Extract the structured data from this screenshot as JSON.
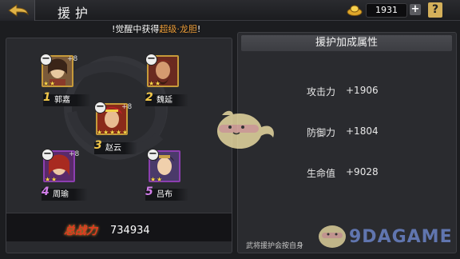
{
  "header": {
    "title": "援护",
    "currency_value": "1931",
    "plus_label": "+",
    "help_label": "?"
  },
  "notice": {
    "prefix": "!觉醒中获得",
    "highlight": "超级·龙胆",
    "suffix": "!"
  },
  "heroes": [
    {
      "slot": "1",
      "name": "郭嘉",
      "level_bonus": "+8",
      "stars": 2,
      "frame": "gold"
    },
    {
      "slot": "2",
      "name": "魏延",
      "level_bonus": "",
      "stars": 2,
      "frame": "gold"
    },
    {
      "slot": "3",
      "name": "赵云",
      "level_bonus": "+8",
      "stars": 5,
      "frame": "gold"
    },
    {
      "slot": "4",
      "name": "周瑜",
      "level_bonus": "+8",
      "stars": 2,
      "frame": "purple"
    },
    {
      "slot": "5",
      "name": "吕布",
      "level_bonus": "",
      "stars": 2,
      "frame": "purple"
    }
  ],
  "power": {
    "label": "总战力",
    "value": "734934"
  },
  "bonus_panel": {
    "title": "援护加成属性",
    "stats": [
      {
        "label": "攻击力",
        "value": "+1906"
      },
      {
        "label": "防御力",
        "value": "+1804"
      },
      {
        "label": "生命值",
        "value": "+9028"
      }
    ]
  },
  "footer_note": "武将援护会按自身",
  "watermark": "9DAGAME",
  "colors": {
    "gold_frame": "#c69a3a",
    "purple_frame": "#8c3fb0",
    "highlight_orange": "#f2a23c",
    "power_red": "#e23a1f"
  }
}
